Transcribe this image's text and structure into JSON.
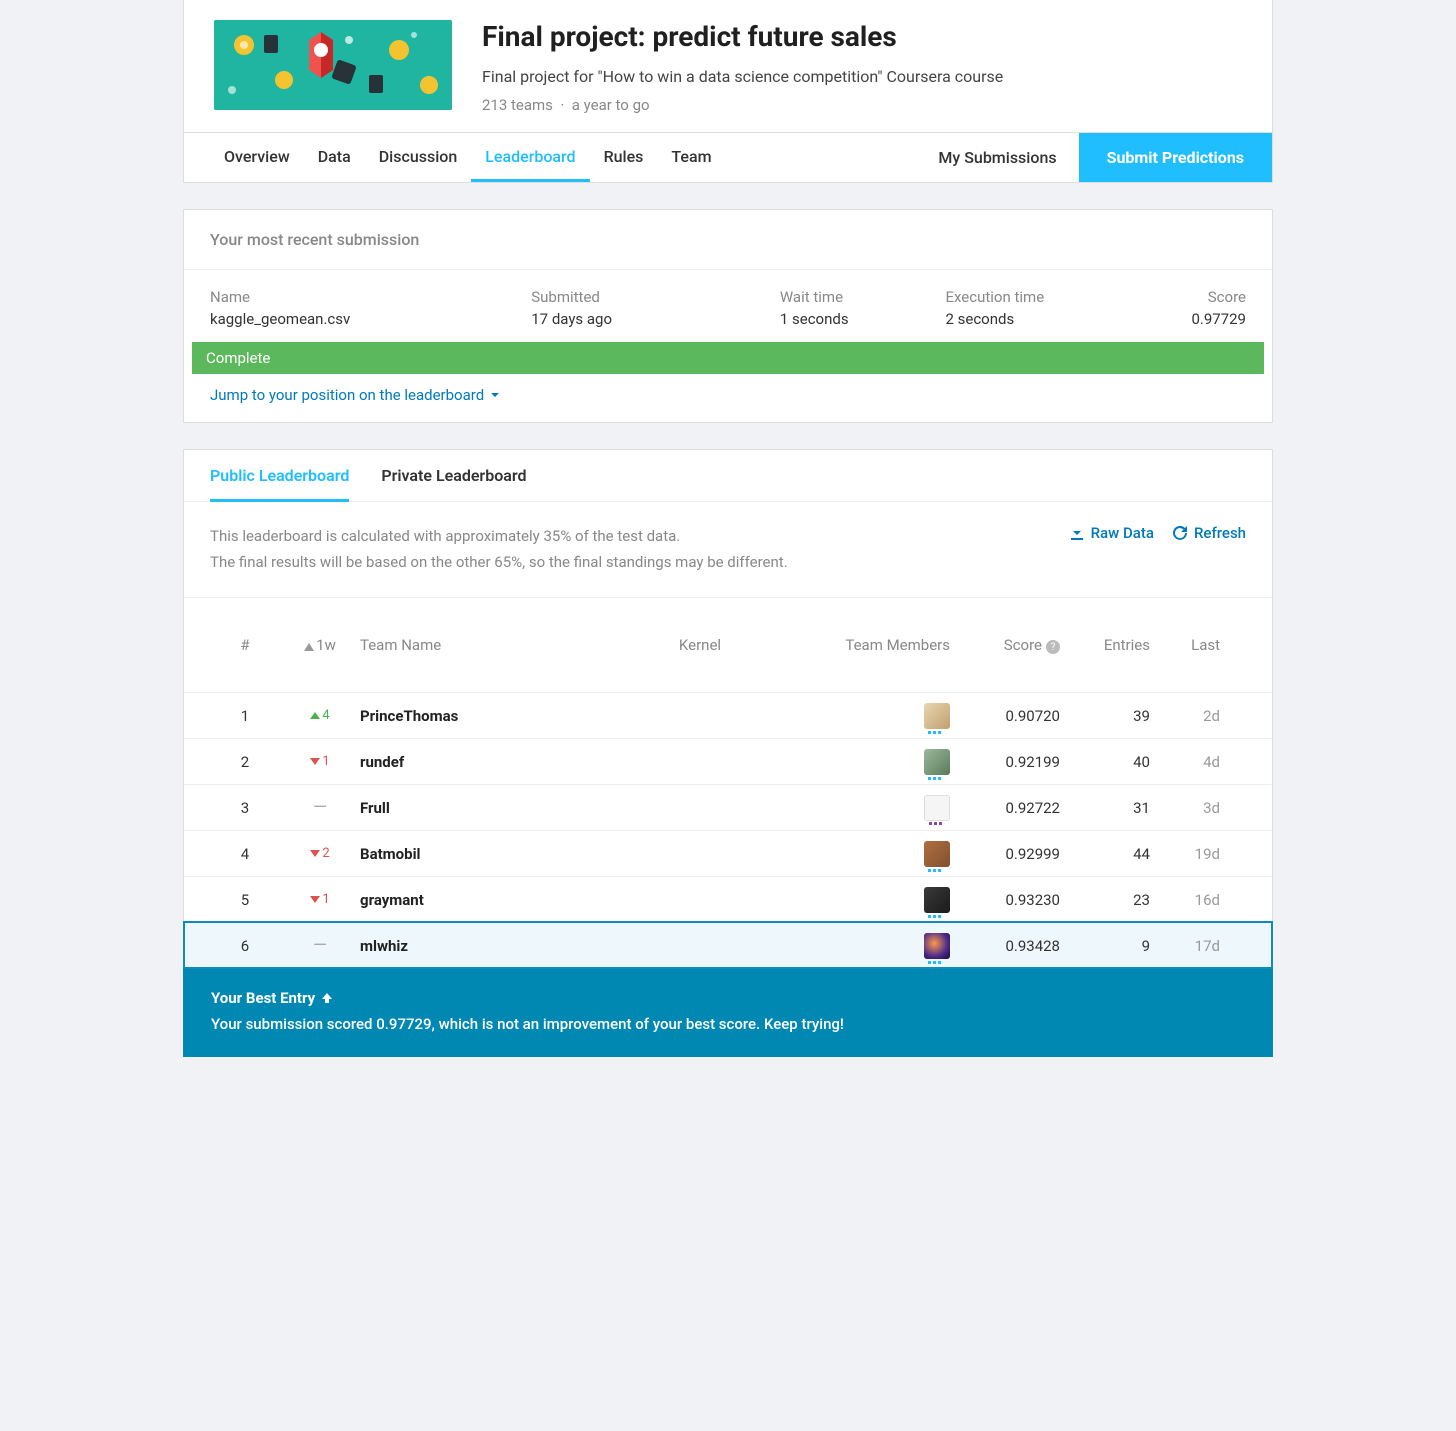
{
  "competition": {
    "title": "Final project: predict future sales",
    "subtitle": "Final project for \"How to win a data science competition\" Coursera course",
    "teams": "213 teams",
    "time_left": "a year to go"
  },
  "tabs": {
    "overview": "Overview",
    "data": "Data",
    "discussion": "Discussion",
    "leaderboard": "Leaderboard",
    "rules": "Rules",
    "team": "Team",
    "my_submissions": "My Submissions",
    "submit": "Submit Predictions"
  },
  "recent": {
    "heading": "Your most recent submission",
    "labels": {
      "name": "Name",
      "submitted": "Submitted",
      "wait": "Wait time",
      "exec": "Execution time",
      "score": "Score"
    },
    "values": {
      "name": "kaggle_geomean.csv",
      "submitted": "17 days ago",
      "wait": "1 seconds",
      "exec": "2 seconds",
      "score": "0.97729"
    },
    "status": "Complete",
    "jump": "Jump to your position on the leaderboard"
  },
  "leaderboard_tabs": {
    "public": "Public Leaderboard",
    "private": "Private Leaderboard"
  },
  "leaderboard_desc": {
    "line1": "This leaderboard is calculated with approximately 35% of the test data.",
    "line2": "The final results will be based on the other 65%, so the final standings may be different."
  },
  "lb_actions": {
    "raw": "Raw Data",
    "refresh": "Refresh"
  },
  "lb_headers": {
    "rank": "#",
    "delta": "1w",
    "team": "Team Name",
    "kernel": "Kernel",
    "members": "Team Members",
    "score": "Score",
    "entries": "Entries",
    "last": "Last"
  },
  "rows": [
    {
      "rank": "1",
      "delta_dir": "up",
      "delta_val": "4",
      "team": "PrinceThomas",
      "score": "0.90720",
      "entries": "39",
      "last": "2d",
      "avatar": "a1"
    },
    {
      "rank": "2",
      "delta_dir": "down",
      "delta_val": "1",
      "team": "rundef",
      "score": "0.92199",
      "entries": "40",
      "last": "4d",
      "avatar": "a2"
    },
    {
      "rank": "3",
      "delta_dir": "same",
      "delta_val": "—",
      "team": "Frull",
      "score": "0.92722",
      "entries": "31",
      "last": "3d",
      "avatar": "a3"
    },
    {
      "rank": "4",
      "delta_dir": "down",
      "delta_val": "2",
      "team": "Batmobil",
      "score": "0.92999",
      "entries": "44",
      "last": "19d",
      "avatar": "a4"
    },
    {
      "rank": "5",
      "delta_dir": "down",
      "delta_val": "1",
      "team": "graymant",
      "score": "0.93230",
      "entries": "23",
      "last": "16d",
      "avatar": "a5"
    },
    {
      "rank": "6",
      "delta_dir": "same",
      "delta_val": "—",
      "team": "mlwhiz",
      "score": "0.93428",
      "entries": "9",
      "last": "17d",
      "avatar": "a6",
      "me": true
    }
  ],
  "best_entry": {
    "title": "Your Best Entry",
    "message": "Your submission scored 0.97729, which is not an improvement of your best score. Keep trying!"
  }
}
